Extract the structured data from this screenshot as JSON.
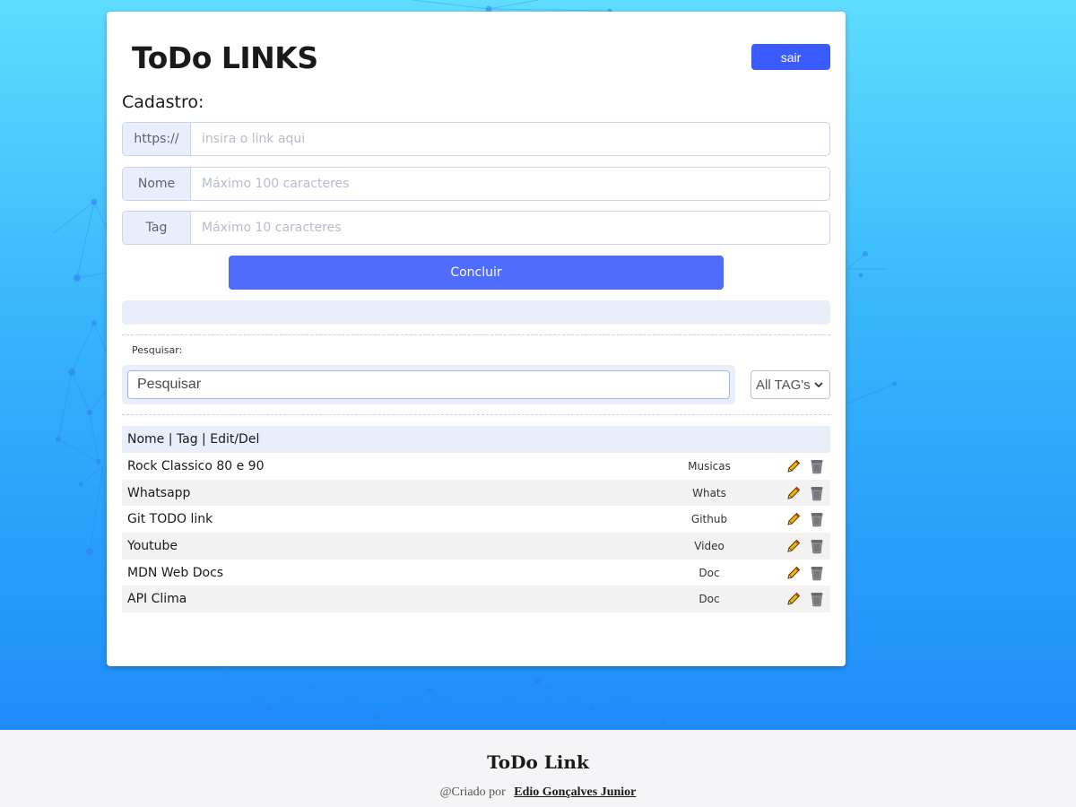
{
  "header": {
    "title": "ToDo LINKS",
    "logout_label": "sair"
  },
  "form": {
    "heading": "Cadastro:",
    "url": {
      "addon": "https://",
      "placeholder": "insira o link aqui",
      "value": ""
    },
    "name": {
      "addon": "Nome",
      "placeholder": "Máximo 100 caracteres",
      "value": ""
    },
    "tag": {
      "addon": "Tag",
      "placeholder": "Máximo 10 caracteres",
      "value": ""
    },
    "submit_label": "Concluir"
  },
  "search": {
    "label": "Pesquisar:",
    "placeholder": "Pesquisar",
    "tag_filter": "All TAG's"
  },
  "table": {
    "header": "Nome | Tag | Edit/Del",
    "rows": [
      {
        "name": "Rock Classico 80 e 90",
        "tag": "Musicas"
      },
      {
        "name": "Whatsapp",
        "tag": "Whats"
      },
      {
        "name": "Git TODO link",
        "tag": "Github"
      },
      {
        "name": "Youtube",
        "tag": "Video"
      },
      {
        "name": "MDN Web Docs",
        "tag": "Doc"
      },
      {
        "name": "API Clima",
        "tag": "Doc"
      }
    ]
  },
  "footer": {
    "title": "ToDo Link",
    "created_by": "@Criado por",
    "author": "Edio Gonçalves Junior"
  },
  "colors": {
    "primary": "#4f6cfc",
    "logout": "#3a5bff",
    "addon_bg": "#e9eefb",
    "bg_top": "#5fdcfe",
    "bg_bottom": "#1f8cfa"
  }
}
